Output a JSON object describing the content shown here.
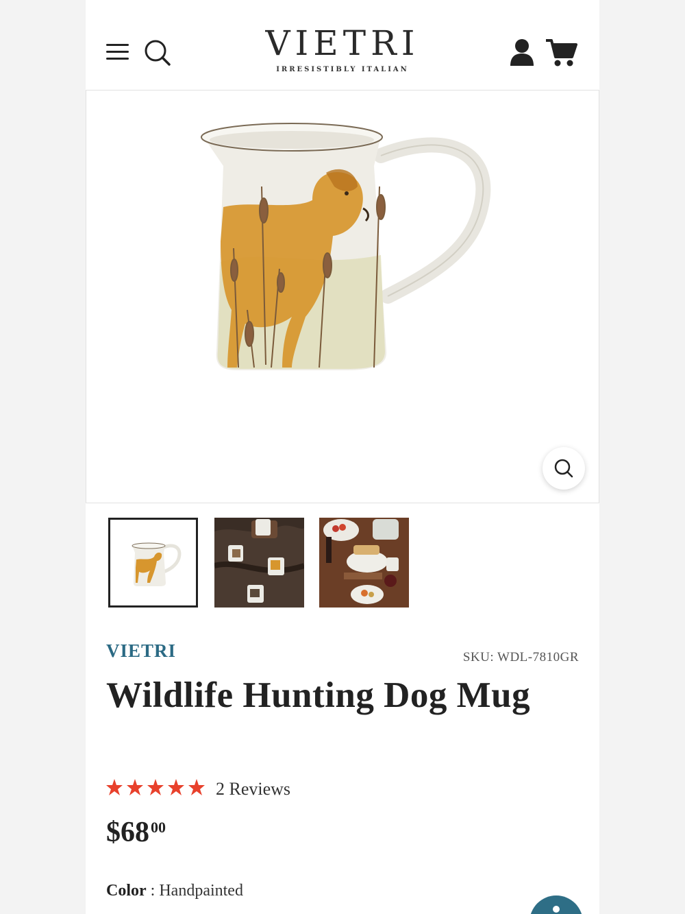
{
  "header": {
    "brand_name": "VIETRI",
    "brand_tagline": "IRRESISTIBLY ITALIAN"
  },
  "product": {
    "vendor": "VIETRI",
    "sku": "SKU: WDL-7810GR",
    "title": "Wildlife Hunting Dog Mug",
    "rating": 5,
    "reviews": "2 Reviews",
    "price_main": "$68",
    "price_cents": "00",
    "color_label": "Color",
    "color_separator": " : ",
    "color_value": "Handpainted"
  },
  "colors": {
    "accent": "#2b6a84",
    "star": "#e8412c"
  },
  "icons": [
    "menu-icon",
    "search-icon",
    "account-icon",
    "cart-icon",
    "zoom-icon",
    "star-icon",
    "help-icon"
  ]
}
